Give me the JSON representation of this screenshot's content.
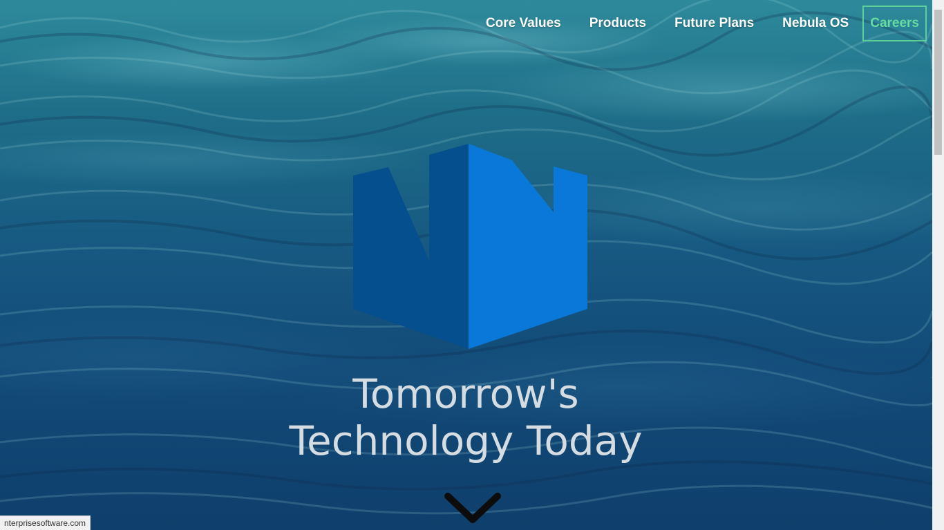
{
  "nav": {
    "items": [
      {
        "label": "Core Values"
      },
      {
        "label": "Products"
      },
      {
        "label": "Future Plans"
      },
      {
        "label": "Nebula OS"
      }
    ],
    "careers_label": "Careers"
  },
  "hero": {
    "tagline_line1": "Tomorrow's",
    "tagline_line2": "Technology Today",
    "logo_icon": "nn-cube-logo-icon",
    "scroll_icon": "chevron-down-icon"
  },
  "status_bar": {
    "url": "nterprisesoftware.com"
  },
  "colors": {
    "accent_green": "#5fd095",
    "logo_dark_blue": "#064f8e",
    "logo_light_blue": "#0a78d8",
    "tagline": "#d5dce2"
  }
}
